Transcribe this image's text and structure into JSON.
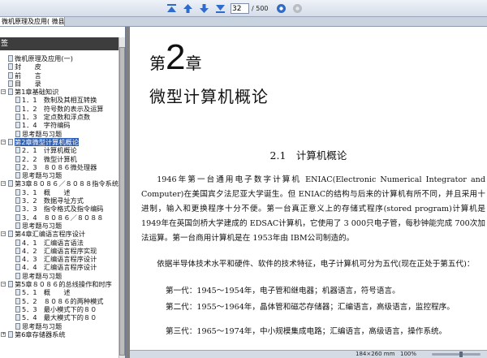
{
  "toolbar": {
    "page_number": "32",
    "page_total": "/ 500",
    "icons": [
      "first-page-icon",
      "prev-page-icon",
      "next-page-icon",
      "last-page-icon",
      "go-icon",
      "stop-icon"
    ]
  },
  "tab": {
    "title": "微机原理及应用( 微县,文..."
  },
  "sidebar": {
    "header": "签",
    "items": [
      {
        "level": 0,
        "toggle": "",
        "label": "微机原理及应用(一)"
      },
      {
        "level": 0,
        "toggle": "",
        "label": "封　　皮"
      },
      {
        "level": 0,
        "toggle": "",
        "label": "前　　言"
      },
      {
        "level": 0,
        "toggle": "",
        "label": "目　　录"
      },
      {
        "level": 0,
        "toggle": "−",
        "label": "第1章基础知识"
      },
      {
        "level": 1,
        "toggle": "",
        "label": "1．1　数制及其相互转换"
      },
      {
        "level": 1,
        "toggle": "",
        "label": "1．2　符号数的表示及运算"
      },
      {
        "level": 1,
        "toggle": "",
        "label": "1．3　定点数和浮点数"
      },
      {
        "level": 1,
        "toggle": "",
        "label": "1．4　字符编码"
      },
      {
        "level": 1,
        "toggle": "",
        "label": "思考题与习题"
      },
      {
        "level": 0,
        "toggle": "−",
        "label": "第2章微型计算机概论",
        "selected": true
      },
      {
        "level": 1,
        "toggle": "",
        "label": "2．1　计算机概论"
      },
      {
        "level": 1,
        "toggle": "",
        "label": "2．2　微型计算机"
      },
      {
        "level": 1,
        "toggle": "",
        "label": "2．3　８０８６微处理器"
      },
      {
        "level": 1,
        "toggle": "",
        "label": "思考题与习题"
      },
      {
        "level": 0,
        "toggle": "−",
        "label": "第3章８０８６／８０８８指令系统"
      },
      {
        "level": 1,
        "toggle": "",
        "label": "3．1　概　　述"
      },
      {
        "level": 1,
        "toggle": "",
        "label": "3．2　数据寻址方式"
      },
      {
        "level": 1,
        "toggle": "",
        "label": "3．3　指令格式及指令编码"
      },
      {
        "level": 1,
        "toggle": "",
        "label": "3．4　８０８６／８０８８"
      },
      {
        "level": 1,
        "toggle": "",
        "label": "思考题与习题"
      },
      {
        "level": 0,
        "toggle": "−",
        "label": "第4章汇编语言程序设计"
      },
      {
        "level": 1,
        "toggle": "",
        "label": "4．1　汇编语言语法"
      },
      {
        "level": 1,
        "toggle": "",
        "label": "4．2　汇编语言程序实现"
      },
      {
        "level": 1,
        "toggle": "",
        "label": "4．3　汇编语言程序设计"
      },
      {
        "level": 1,
        "toggle": "",
        "label": "4．4　汇编语言程序设计"
      },
      {
        "level": 1,
        "toggle": "",
        "label": "思考题与习题"
      },
      {
        "level": 0,
        "toggle": "−",
        "label": "第5章８０８６的总线操作和时序"
      },
      {
        "level": 1,
        "toggle": "",
        "label": "5．1　概　　述"
      },
      {
        "level": 1,
        "toggle": "",
        "label": "5．2　８０８６的两种模式"
      },
      {
        "level": 1,
        "toggle": "",
        "label": "5．3　最小模式下的８０"
      },
      {
        "level": 1,
        "toggle": "",
        "label": "5．4　最大模式下的８０"
      },
      {
        "level": 1,
        "toggle": "",
        "label": "思考题与习题"
      },
      {
        "level": 0,
        "toggle": "+",
        "label": "第6章存储器系统"
      }
    ]
  },
  "document": {
    "chapter_prefix": "第",
    "chapter_number": "2",
    "chapter_suffix": "章",
    "chapter_title": "微型计算机概论",
    "section_title": "2.1　计算机概论",
    "para1": "1946年第一台通用电子数字计算机 ENIAC(Electronic Numerical Integrator and Computer)在美国宾夕法尼亚大学诞生。但 ENIAC的结构与后来的计算机有所不同，并且采用十进制，输入和更换程序十分不便。第一台真正意义上的存储式程序(stored program)计算机是 1949年在英国剑桥大学建成的 EDSAC计算机，它使用了 3 000只电子管，每秒钟能完成 700次加法运算。第一台商用计算机是在 1953年由 IBM公司制造的。",
    "para2": "依据半导体技术水平和硬件、软件的技术特征，电子计算机可分为五代(现在正处于第五代)：",
    "era1": "第一代：1945～1954年，电子管和继电器；机器语言，符号语言。",
    "era2": "第二代：1955～1964年，晶体管和磁芯存储器；汇编语言，高级语言，监控程序。",
    "era3": "第三代：1965～1974年，中小规模集成电路；汇编语言，高级语言，操作系统。"
  },
  "statusbar": {
    "page_size": "184×260 mm",
    "zoom": "100%",
    "zoom_level": 0.6
  }
}
